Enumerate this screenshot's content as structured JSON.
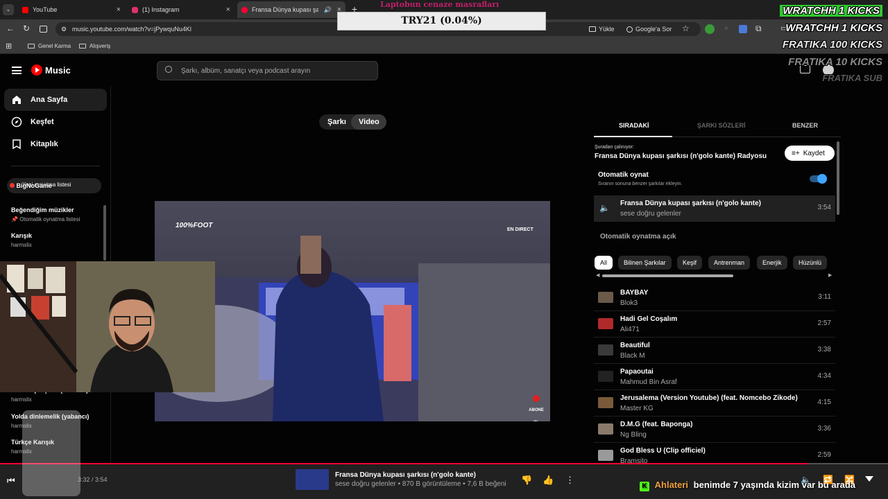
{
  "browser": {
    "tabs": [
      {
        "label": "YouTube",
        "color": "#ff0000"
      },
      {
        "label": "(1) Instagram",
        "color": "#e1306c"
      },
      {
        "label": "Fransa Dünya kupası şarkısı",
        "color": "#ff0033",
        "active": true
      }
    ],
    "url": "music.youtube.com/watch?v=jPywquNu4Kl",
    "actions": {
      "upload": "Yükle",
      "ask_google": "Google'a Sor"
    },
    "bookmarks": [
      "Genel Karma",
      "Alışveriş"
    ]
  },
  "overlay": {
    "donation_title": "Laptobun cenaze masrafları",
    "donation_amount": "TRY21 (0.04%)",
    "kicks": [
      "WRATCHH  1 KICKS",
      "WRATCHH  1 KICKS",
      "FRATIKA  100 KICKS",
      "FRATIKA  10 KICKS",
      "FRATIKA  SUB"
    ],
    "sidebar_overlay_text": "BigNoGame",
    "chat_user": "Ahlateri",
    "chat_message": "benimde 7 yaşında kizim var bu arada"
  },
  "ytm": {
    "brand": "Music",
    "search_placeholder": "Şarkı, albüm, sanatçı veya podcast arayın",
    "nav": [
      {
        "label": "Ana Sayfa",
        "icon": "home-icon"
      },
      {
        "label": "Keşfet",
        "icon": "compass-icon"
      },
      {
        "label": "Kitaplık",
        "icon": "library-icon"
      }
    ],
    "new_playlist": "Yeni oynatma listesi",
    "playlists": [
      {
        "title": "Beğendiğim müzikler",
        "sub": "Otomatik oynatma listesi"
      },
      {
        "title": "Karışık",
        "sub": "harmslix"
      },
      {
        "title": "Günlük parçalar (Yabancı)",
        "sub": "harmslix"
      },
      {
        "title": "Yolda dinlemelik (yabancı)",
        "sub": "harmslix"
      },
      {
        "title": "Türkçe Karışık",
        "sub": "harmslix"
      }
    ],
    "mode_toggle": {
      "song": "Şarkı",
      "video": "Video",
      "selected": "Video"
    },
    "video_overlay": {
      "logo": "100%FOOT",
      "channel": "EN DIRECT",
      "subscribe": "ABONE OL"
    },
    "right_tabs": [
      "SIRADAKİ",
      "ŞARKI SÖZLERİ",
      "BENZER"
    ],
    "playing_from_label": "Şuradan çalınıyor:",
    "playing_from": "Fransa Dünya kupası şarkısı (n'golo kante) Radyosu",
    "save_button": "Kaydet",
    "autoplay_title": "Otomatik oynat",
    "autoplay_sub": "Sıranın sonuna benzer şarkılar ekleyin.",
    "autoplay_on": true,
    "current": {
      "title": "Fransa Dünya kupası şarkısı (n'golo kante)",
      "artist": "sese doğru gelenler",
      "duration": "3:54"
    },
    "autoplay_section": "Otomatik oynatma açık",
    "chips": [
      "All",
      "Bilinen Şarkılar",
      "Keşif",
      "Antrenman",
      "Enerjik",
      "Hüzünlü"
    ],
    "queue": [
      {
        "title": "BAYBAY",
        "artist": "Blok3",
        "duration": "3:11",
        "thumb": "#6b5a4a"
      },
      {
        "title": "Hadi Gel Coşalım",
        "artist": "Ali471",
        "duration": "2:57",
        "thumb": "#b02a2a"
      },
      {
        "title": "Beautiful",
        "artist": "Black M",
        "duration": "3:38",
        "thumb": "#3a3a3a"
      },
      {
        "title": "Papaoutai",
        "artist": "Mahmud Bin Asraf",
        "duration": "4:34",
        "thumb": "#222222"
      },
      {
        "title": "Jerusalema (Version Youtube) (feat. Nomcebo Zikode)",
        "artist": "Master KG",
        "duration": "4:15",
        "thumb": "#7a5a3a"
      },
      {
        "title": "D.M.G (feat. Baponga)",
        "artist": "Ng Bling",
        "duration": "3:36",
        "thumb": "#8a7a6a"
      },
      {
        "title": "God Bless U (Clip officiel)",
        "artist": "Bramsito",
        "duration": "2:59",
        "thumb": "#9a9a9a"
      }
    ],
    "player": {
      "time": "3:32 / 3:54",
      "title": "Fransa Dünya kupası şarkısı (n'golo kante)",
      "meta": "sese doğru gelenler • 870 B görüntüleme • 7,6 B beğeni"
    }
  }
}
